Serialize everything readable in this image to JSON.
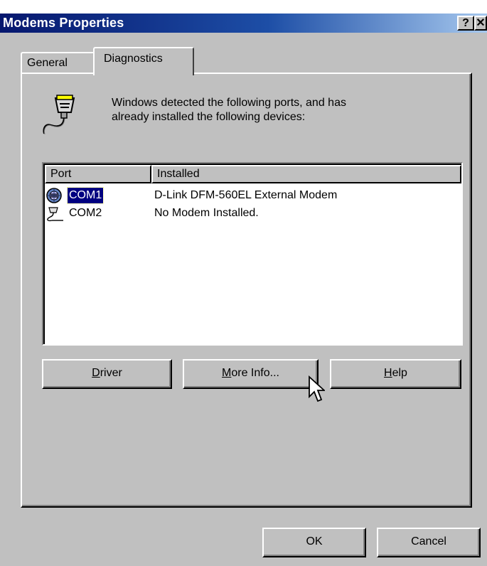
{
  "window": {
    "title": "Modems Properties",
    "help_glyph": "?",
    "close_glyph": "✕"
  },
  "tabs": [
    {
      "label": "General",
      "active": false
    },
    {
      "label": "Diagnostics",
      "active": true
    }
  ],
  "intro": {
    "line1": "Windows detected the following ports, and has",
    "line2": "already installed the following devices:"
  },
  "listview": {
    "columns": [
      "Port",
      "Installed"
    ],
    "rows": [
      {
        "port": "COM1",
        "installed": "D-Link DFM-560EL External Modem",
        "selected": true,
        "icon": "modem-port-icon"
      },
      {
        "port": "COM2",
        "installed": "No Modem Installed.",
        "selected": false,
        "icon": "serial-port-icon"
      }
    ]
  },
  "buttons": {
    "driver": {
      "mnemonic": "D",
      "rest": "river"
    },
    "more_info": {
      "mnemonic": "M",
      "rest": "ore Info..."
    },
    "help": {
      "mnemonic": "H",
      "rest": "elp"
    },
    "ok": "OK",
    "cancel": "Cancel"
  },
  "colors": {
    "title_bar_start": "#06176e",
    "title_bar_end": "#a6c8ee",
    "face": "#c0c0c0",
    "selection": "#000080"
  }
}
